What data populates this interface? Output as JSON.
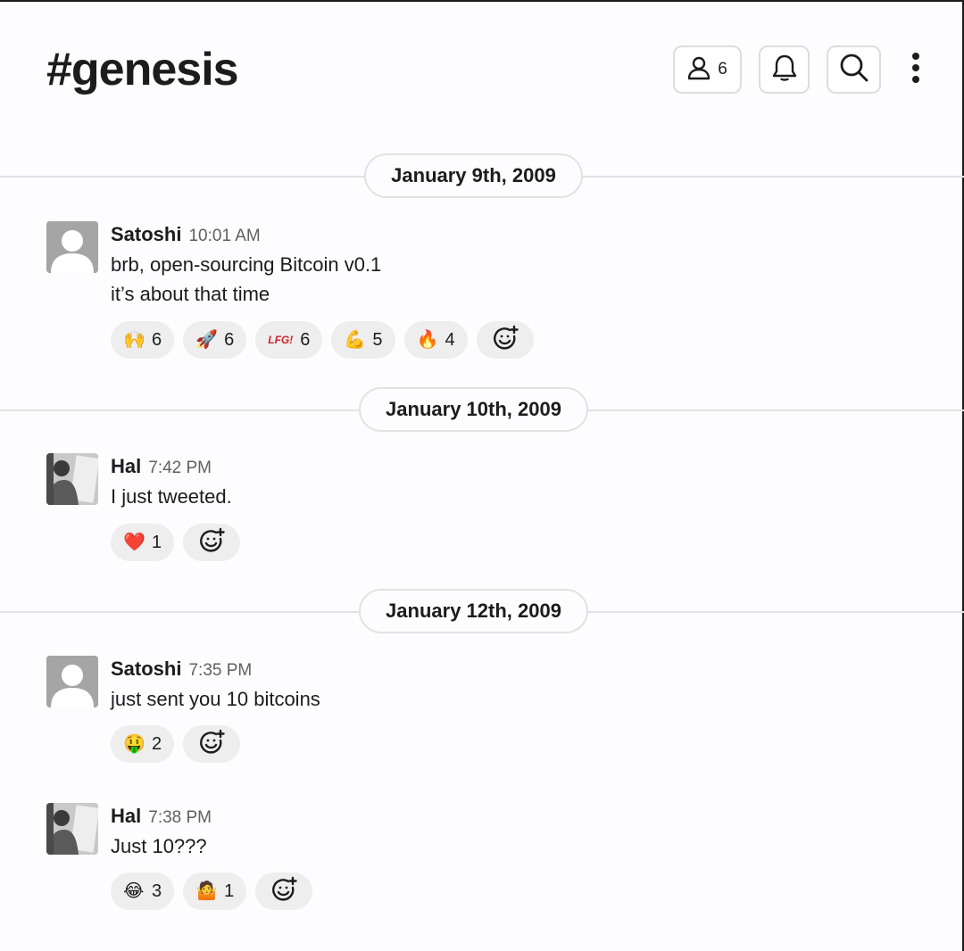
{
  "channel": {
    "name": "#genesis"
  },
  "header": {
    "members_count": "6",
    "icons": {
      "members": "person-icon",
      "bell": "bell-icon",
      "search": "search-icon",
      "more": "kebab-menu-icon"
    }
  },
  "dates": [
    "January 9th, 2009",
    "January 10th, 2009",
    "January 12th, 2009"
  ],
  "messages": [
    {
      "author": "Satoshi",
      "time": "10:01 AM",
      "avatar": "default-avatar",
      "lines": [
        "brb, open-sourcing Bitcoin v0.1",
        "it’s about that time"
      ],
      "reactions": [
        {
          "emoji": "🙌",
          "count": "6"
        },
        {
          "emoji": "🚀",
          "count": "6"
        },
        {
          "emoji": "LFG!",
          "count": "6"
        },
        {
          "emoji": "💪",
          "count": "5"
        },
        {
          "emoji": "🔥",
          "count": "4"
        }
      ]
    },
    {
      "author": "Hal",
      "time": "7:42 PM",
      "avatar": "photo-avatar",
      "lines": [
        "I just tweeted."
      ],
      "reactions": [
        {
          "emoji": "❤️",
          "count": "1"
        }
      ]
    },
    {
      "author": "Satoshi",
      "time": "7:35 PM",
      "avatar": "default-avatar",
      "lines": [
        "just sent you 10 bitcoins"
      ],
      "reactions": [
        {
          "emoji": "🤑",
          "count": "2"
        }
      ]
    },
    {
      "author": "Hal",
      "time": "7:38 PM",
      "avatar": "photo-avatar",
      "lines": [
        "Just 10???"
      ],
      "reactions": [
        {
          "emoji": "😂",
          "count": "3"
        },
        {
          "emoji": "🤷",
          "count": "1"
        }
      ]
    }
  ],
  "colors": {
    "background": "#fdfcfe",
    "text": "#1d1c1d",
    "muted": "#616061",
    "reaction_bg": "#eeeeef",
    "border": "#dddddd"
  }
}
